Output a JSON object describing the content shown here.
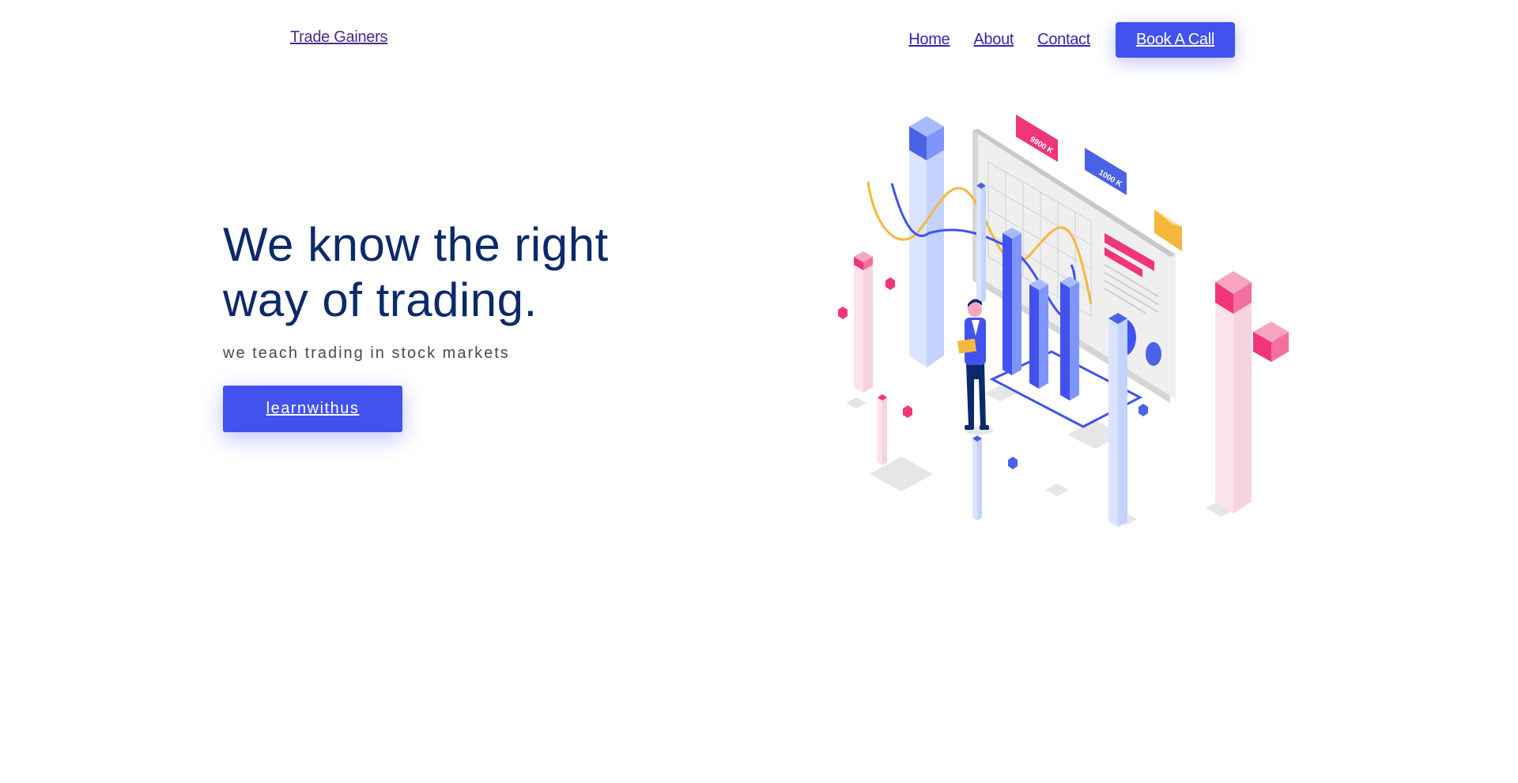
{
  "header": {
    "brand": "Trade Gainers",
    "nav": {
      "home": "Home",
      "about": "About",
      "contact": "Contact",
      "cta": "Book A Call"
    }
  },
  "hero": {
    "title": "We know the right way of trading.",
    "subtitle": "we teach trading in stock markets",
    "button": "learnwithus"
  },
  "illustration": {
    "badge_likes": "9900 K",
    "badge_users": "1000 K"
  },
  "colors": {
    "accent": "#4152ef",
    "heading": "#0b2a6b",
    "pink": "#f0357a",
    "yellow": "#f5b73b"
  }
}
